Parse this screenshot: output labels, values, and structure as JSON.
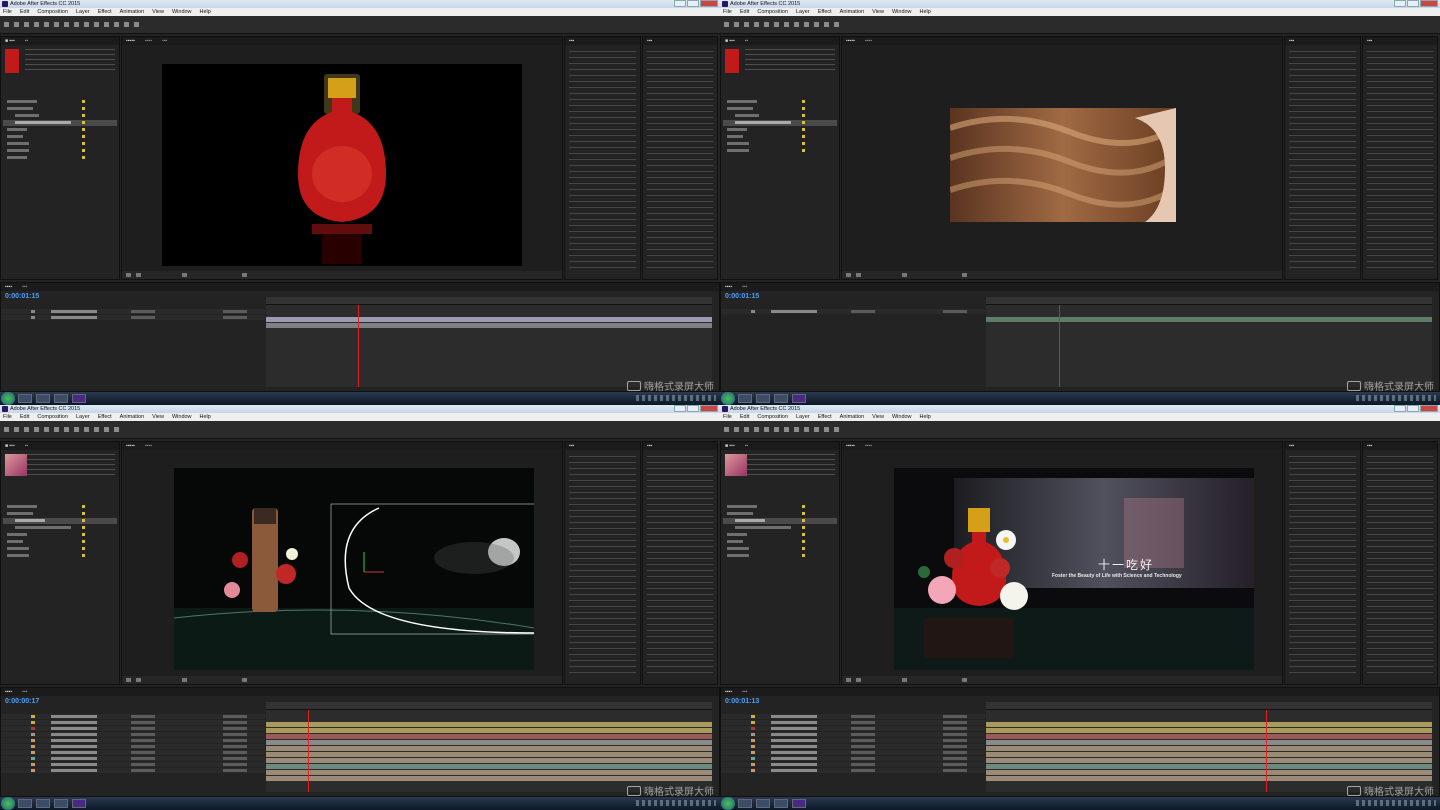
{
  "app_title": "Adobe After Effects CC 2015",
  "menu": [
    "File",
    "Edit",
    "Composition",
    "Layer",
    "Effect",
    "Animation",
    "View",
    "Window",
    "Help"
  ],
  "quadrants": [
    {
      "timecode": "0:00:01:15",
      "viewer_subject": "red-liquor-bottle"
    },
    {
      "timecode": "0:00:01:15",
      "viewer_subject": "hair-model"
    },
    {
      "timecode": "0:00:00:17",
      "viewer_subject": "product-scene-with-motion-path"
    },
    {
      "timecode": "0:00:01:13",
      "viewer_subject": "final-composite",
      "overlay_title": "十一吃好",
      "overlay_subtitle": "Foster the Beauty of Life with Science and Technology"
    }
  ],
  "watermark": "嗨格式录屏大师",
  "colors": {
    "accent": "#4aa2ff",
    "playhead": "#d22222",
    "bottle_red": "#c21a1a",
    "gold": "#d4a017"
  }
}
